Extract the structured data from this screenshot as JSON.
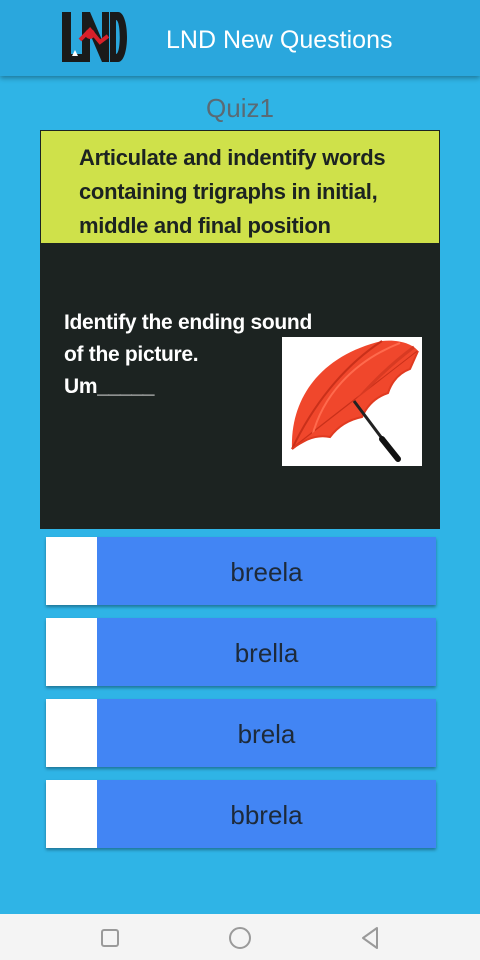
{
  "app": {
    "title": "LND New Questions",
    "logo_text": "LND"
  },
  "quiz": {
    "title": "Quiz1",
    "objective": "Articulate and indentify words containing trigraphs in initial, middle and final position",
    "question_lines": [
      "Identify the ending sound",
      "of the picture.",
      "Um_____"
    ],
    "image": "umbrella-image"
  },
  "options": [
    "breela",
    "brella",
    "brela",
    "bbrela"
  ],
  "nav": [
    "recent-apps-icon",
    "home-icon",
    "back-icon"
  ],
  "colors": {
    "background": "#2fb4e6",
    "appbar": "#2aa7dd",
    "objective_bg": "#cfe14a",
    "card_bg": "#1c2321",
    "option_bg": "#4285f4"
  }
}
